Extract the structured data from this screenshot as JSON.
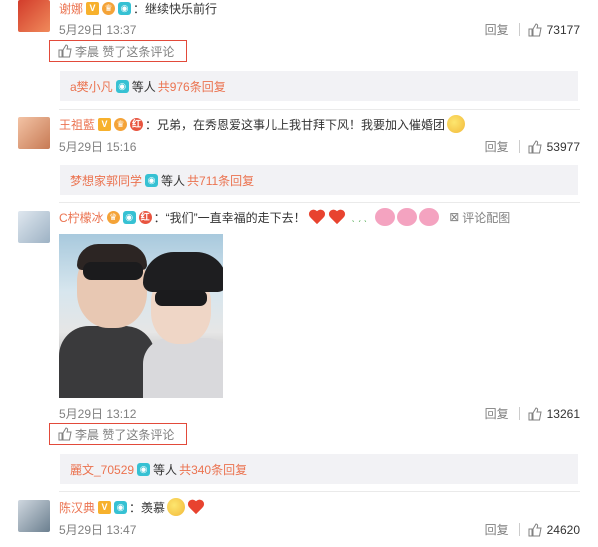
{
  "comments": [
    {
      "username": "谢娜",
      "text": "：继续快乐前行",
      "time": "5月29日 13:37",
      "reply_label": "回复",
      "likes": "73177",
      "liked_by_text": "李晨 赞了这条评论",
      "replies": {
        "name": "a樊小凡",
        "rest": "等人",
        "count": "共976条回复"
      }
    },
    {
      "username": "王祖藍",
      "text": "：兄弟，在秀恩爱这事儿上我甘拜下风！我要加入催婚团",
      "time": "5月29日 15:16",
      "reply_label": "回复",
      "likes": "53977",
      "replies": {
        "name": "梦想家郭同学",
        "rest": "等人",
        "count": "共711条回复"
      }
    },
    {
      "username": "C柠檬冰",
      "text": "：“我们”一直幸福的走下去！",
      "pic_link": "评论配图",
      "time": "5月29日 13:12",
      "reply_label": "回复",
      "likes": "13261",
      "liked_by_text": "李晨 赞了这条评论",
      "replies": {
        "name": "麗文_70529",
        "rest": "等人",
        "count": "共340条回复"
      }
    },
    {
      "username": "陈汉典",
      "text": "：羡慕",
      "time": "5月29日 13:47",
      "reply_label": "回复",
      "likes": "24620"
    }
  ],
  "colors": {
    "accent": "#eb7350",
    "highlight_border": "#e24a3a",
    "reply_bg": "#f2f2f5",
    "meta": "#808080"
  }
}
